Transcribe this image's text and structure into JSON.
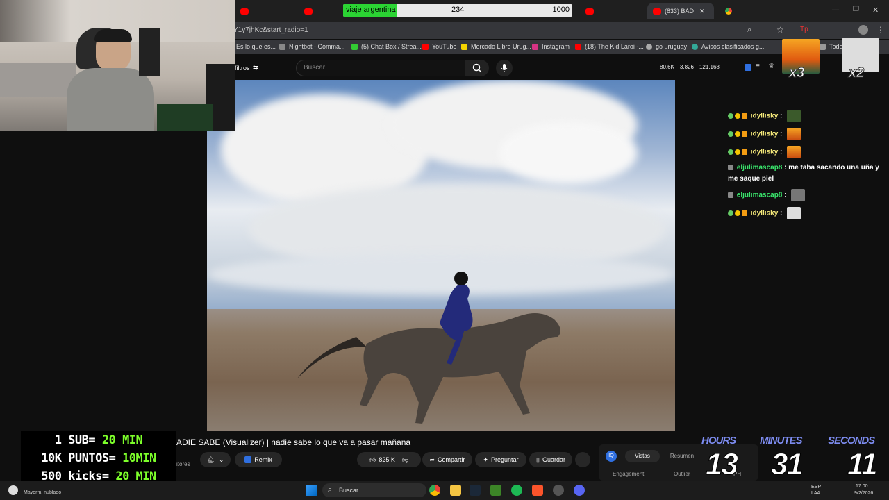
{
  "browser": {
    "tabs": [
      {
        "label": ""
      },
      {
        "label": ""
      },
      {
        "label": "(833) BAD"
      }
    ],
    "url": "Y1y7jhKc&start_radio=1",
    "bookmarks": [
      "Es lo que es...",
      "Nightbot - Comma...",
      "(5) Chat Box / Strea...",
      "YouTube",
      "Mercado Libre Urug...",
      "Instagram",
      "(18) The Kid Laroi -...",
      "go uruguay",
      "Avisos clasificados g...",
      "Todos"
    ]
  },
  "goal": {
    "label": "viaje argentina",
    "current": "234",
    "target": "1000",
    "progress": 0.234
  },
  "youtube": {
    "filters_label": "filtros",
    "search_placeholder": "Buscar",
    "stats": {
      "a": "80.6K",
      "b": "3,826",
      "c": "121,168"
    },
    "video_title": "ADIE SABE (Visualizer) | nadie sabe lo que va a pasar mañana",
    "actions": {
      "remix": "Remix",
      "likes": "825 K",
      "share": "Compartir",
      "ask": "Preguntar",
      "save": "Guardar"
    },
    "channel_sub_text": "itores",
    "panel": {
      "tab_views": "Vistas",
      "tab_summary": "Resumen",
      "engagement": "Engagement",
      "outlier": "Outlier",
      "ph": "PH"
    }
  },
  "chat": {
    "messages": [
      {
        "user": "idyllisky",
        "text": "",
        "type": "a"
      },
      {
        "user": "idyllisky",
        "text": "",
        "type": "a"
      },
      {
        "user": "idyllisky",
        "text": "",
        "type": "a"
      },
      {
        "user": "eljulimascap8",
        "text": "me taba sacando una uña y me saque piel",
        "type": "b"
      },
      {
        "user": "eljulimascap8",
        "text": "",
        "type": "b"
      },
      {
        "user": "idyllisky",
        "text": "",
        "type": "a"
      }
    ],
    "multipliers": {
      "left": "x3",
      "right": "x2"
    }
  },
  "overlay": {
    "sub_lines": [
      {
        "pre": "1 SUB= ",
        "val": "20 MIN"
      },
      {
        "pre": "10K PUNTOS= ",
        "val": "10MIN"
      },
      {
        "pre": "500 kicks= ",
        "val": "20 MIN"
      }
    ],
    "timer": {
      "hours_label": "HOURS",
      "minutes_label": "MINUTES",
      "seconds_label": "SECONDS",
      "hours": "13",
      "minutes": "31",
      "seconds": "11"
    }
  },
  "taskbar": {
    "weather": "Mayorm. nublado",
    "search": "Buscar",
    "lang": "ESP",
    "lang2": "LAA",
    "time": "17:00",
    "date": "9/2/2026"
  }
}
